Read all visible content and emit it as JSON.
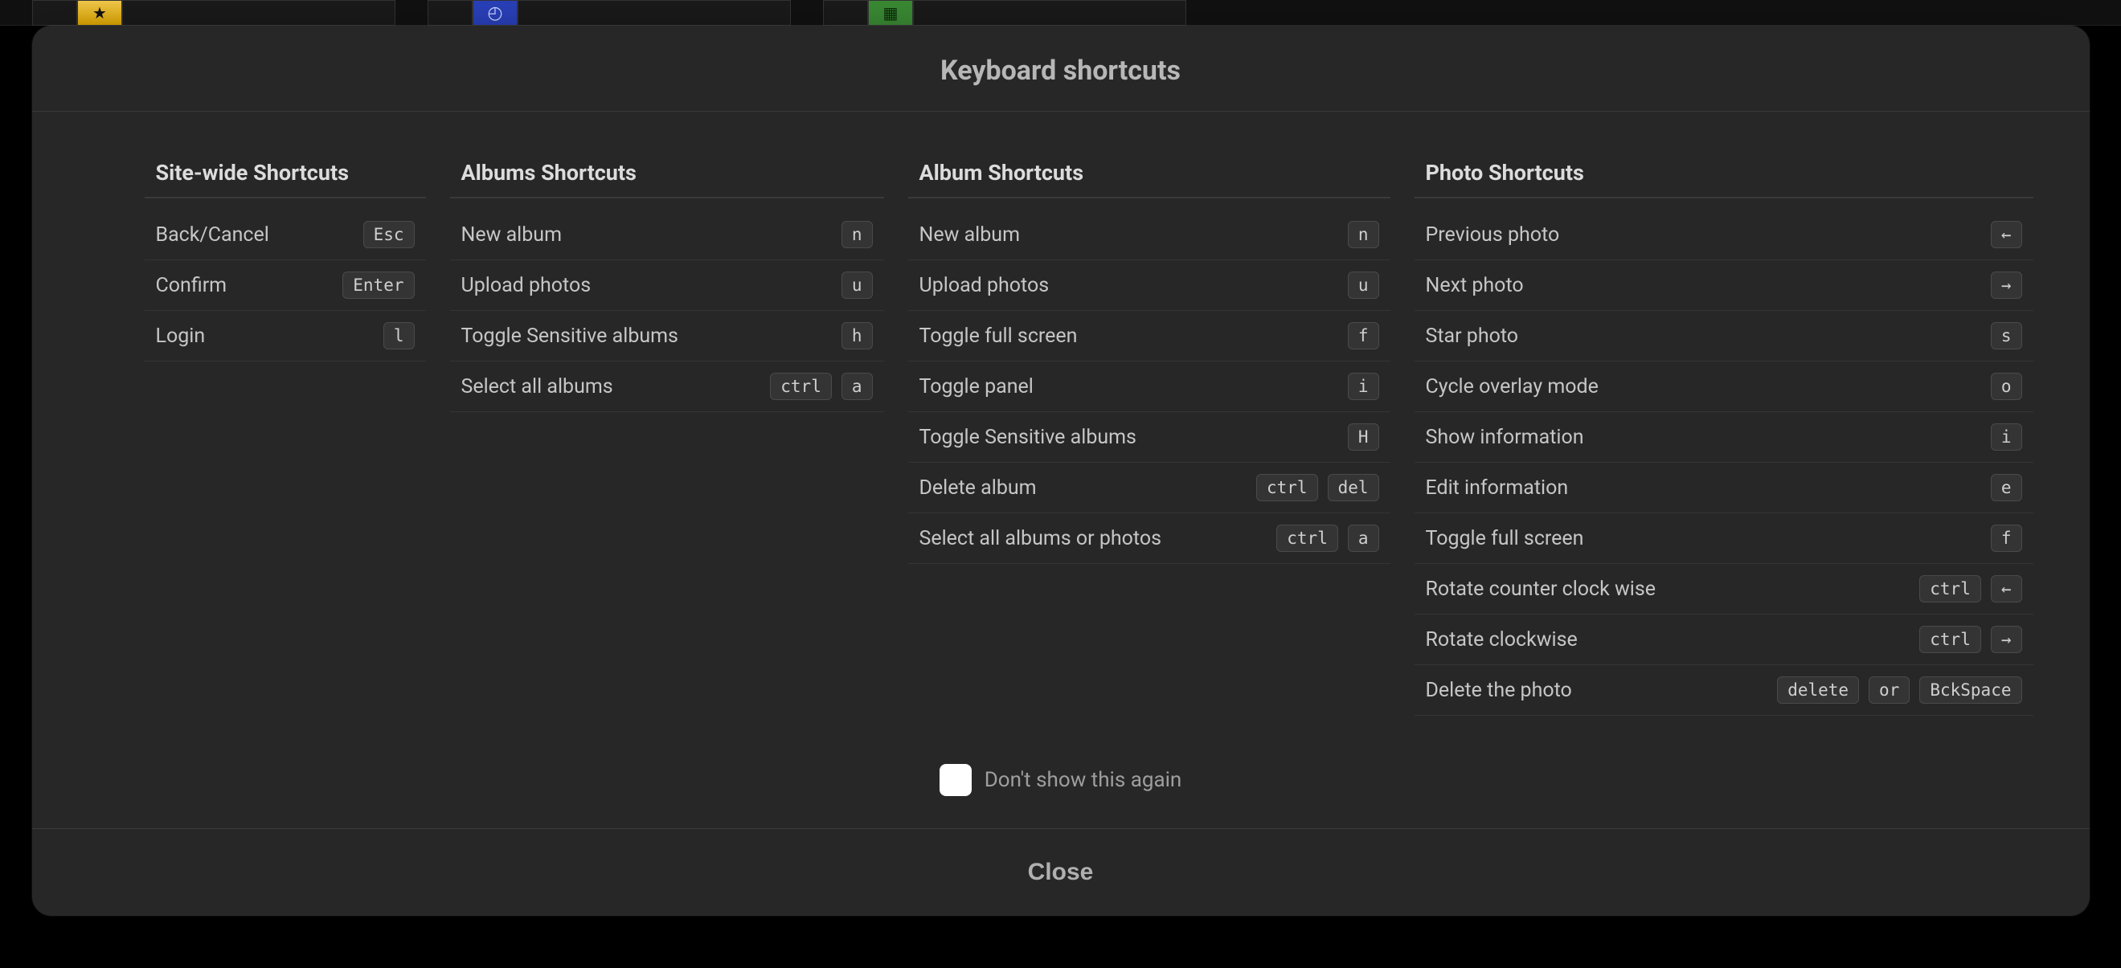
{
  "modal": {
    "title": "Keyboard shortcuts",
    "dont_show": "Don't show this again",
    "close": "Close"
  },
  "columns": [
    {
      "title": "Site-wide Shortcuts",
      "rows": [
        {
          "action": "Back/Cancel",
          "keys": [
            "Esc"
          ]
        },
        {
          "action": "Confirm",
          "keys": [
            "Enter"
          ]
        },
        {
          "action": "Login",
          "keys": [
            "l"
          ]
        }
      ]
    },
    {
      "title": "Albums Shortcuts",
      "rows": [
        {
          "action": "New album",
          "keys": [
            "n"
          ]
        },
        {
          "action": "Upload photos",
          "keys": [
            "u"
          ]
        },
        {
          "action": "Toggle Sensitive albums",
          "keys": [
            "h"
          ]
        },
        {
          "action": "Select all albums",
          "keys": [
            "ctrl",
            "a"
          ]
        }
      ]
    },
    {
      "title": "Album Shortcuts",
      "rows": [
        {
          "action": "New album",
          "keys": [
            "n"
          ]
        },
        {
          "action": "Upload photos",
          "keys": [
            "u"
          ]
        },
        {
          "action": "Toggle full screen",
          "keys": [
            "f"
          ]
        },
        {
          "action": "Toggle panel",
          "keys": [
            "i"
          ]
        },
        {
          "action": "Toggle Sensitive albums",
          "keys": [
            "H"
          ]
        },
        {
          "action": "Delete album",
          "keys": [
            "ctrl",
            "del"
          ]
        },
        {
          "action": "Select all albums or photos",
          "keys": [
            "ctrl",
            "a"
          ]
        }
      ]
    },
    {
      "title": "Photo Shortcuts",
      "rows": [
        {
          "action": "Previous photo",
          "keys": [
            "←"
          ]
        },
        {
          "action": "Next photo",
          "keys": [
            "→"
          ]
        },
        {
          "action": "Star photo",
          "keys": [
            "s"
          ]
        },
        {
          "action": "Cycle overlay mode",
          "keys": [
            "o"
          ]
        },
        {
          "action": "Show information",
          "keys": [
            "i"
          ]
        },
        {
          "action": "Edit information",
          "keys": [
            "e"
          ]
        },
        {
          "action": "Toggle full screen",
          "keys": [
            "f"
          ]
        },
        {
          "action": "Rotate counter clock wise",
          "keys": [
            "ctrl",
            "←"
          ]
        },
        {
          "action": "Rotate clockwise",
          "keys": [
            "ctrl",
            "→"
          ]
        },
        {
          "action": "Delete the photo",
          "keys": [
            "delete",
            "or",
            "BckSpace"
          ]
        }
      ]
    }
  ]
}
